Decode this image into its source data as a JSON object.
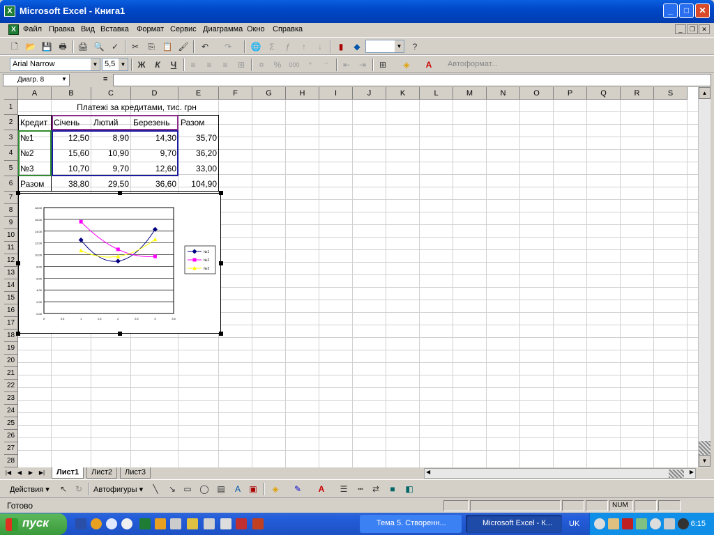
{
  "window": {
    "title": "Microsoft Excel - Книга1",
    "icon": "excel-icon"
  },
  "menu": [
    "Файл",
    "Правка",
    "Вид",
    "Вставка",
    "Формат",
    "Сервис",
    "Диаграмма",
    "Окно",
    "Справка"
  ],
  "format_toolbar": {
    "font": "Arial Narrow",
    "size": "5,5",
    "bold": "Ж",
    "italic": "К",
    "underline": "Ч",
    "percent": "%",
    "thousands": "000",
    "autoformat": "Автоформат..."
  },
  "formula": {
    "namebox": "Диагр. 8",
    "eq": "=",
    "value": ""
  },
  "columns": [
    "A",
    "B",
    "C",
    "D",
    "E",
    "F",
    "G",
    "H",
    "I",
    "J",
    "K",
    "L",
    "M",
    "N",
    "O",
    "P",
    "Q",
    "R",
    "S"
  ],
  "rows": [
    "1",
    "2",
    "3",
    "4",
    "5",
    "6",
    "7",
    "8",
    "9",
    "10",
    "11",
    "12",
    "13",
    "14",
    "15",
    "16",
    "17",
    "18",
    "19",
    "20",
    "21",
    "22",
    "23",
    "24",
    "25",
    "26",
    "27",
    "28"
  ],
  "sheet": {
    "title": "Платежі за кредитами, тис. грн",
    "headers": [
      "Кредит",
      "Січень",
      "Лютий",
      "Березень",
      "Разом"
    ],
    "data": [
      [
        "№1",
        "12,50",
        "8,90",
        "14,30",
        "35,70"
      ],
      [
        "№2",
        "15,60",
        "10,90",
        "9,70",
        "36,20"
      ],
      [
        "№3",
        "10,70",
        "9,70",
        "12,60",
        "33,00"
      ],
      [
        "Разом",
        "38,80",
        "29,50",
        "36,60",
        "104,90"
      ]
    ]
  },
  "chart_data": {
    "type": "line",
    "x": [
      1,
      2,
      3
    ],
    "series": [
      {
        "name": "№1",
        "values": [
          12.5,
          8.9,
          14.3
        ],
        "color": "#000080"
      },
      {
        "name": "№2",
        "values": [
          15.6,
          10.9,
          9.7
        ],
        "color": "#ff00ff"
      },
      {
        "name": "№3",
        "values": [
          10.7,
          9.7,
          12.6
        ],
        "color": "#ffff00"
      }
    ],
    "y_ticks": [
      "0,00",
      "2,00",
      "4,00",
      "6,00",
      "8,00",
      "10,00",
      "12,00",
      "14,00",
      "16,00",
      "18,00"
    ],
    "x_ticks": [
      "0",
      "0,5",
      "1",
      "1,5",
      "2",
      "2,5",
      "3",
      "3,5"
    ],
    "ylim": [
      0,
      18
    ],
    "xlim": [
      0,
      3.5
    ],
    "grid": true,
    "legend": "right"
  },
  "sheet_tabs": [
    "Лист1",
    "Лист2",
    "Лист3"
  ],
  "drawing": {
    "actions": "Действия",
    "autoshapes": "Автофигуры"
  },
  "status": {
    "ready": "Готово",
    "num": "NUM"
  },
  "taskbar": {
    "start": "пуск",
    "tasks": [
      "Тема 5. Створенн...",
      "Microsoft Excel - К..."
    ],
    "lang": "UK",
    "clock": "6:15"
  }
}
